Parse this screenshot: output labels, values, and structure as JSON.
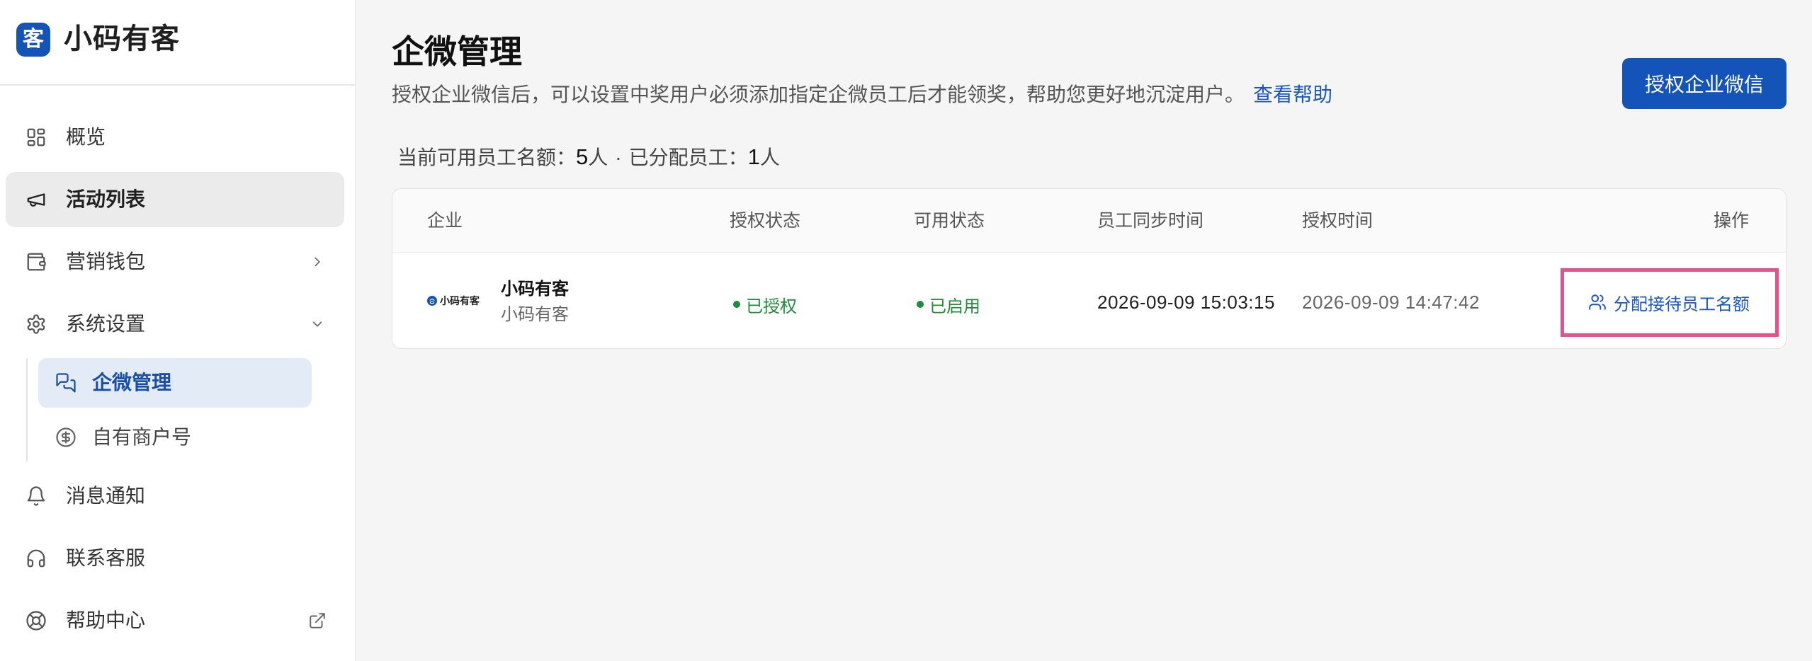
{
  "app": {
    "name": "小码有客",
    "logo_glyph": "客"
  },
  "colors": {
    "primary": "#1453b8",
    "link": "#1a56c4",
    "success": "#1e8c3a",
    "highlight": "#e8508c",
    "sidebar_active_bg": "#ebebeb",
    "submenu_active_bg": "#e3ebf7",
    "submenu_active_text": "#1a4fa8"
  },
  "sidebar": {
    "items": [
      {
        "label": "概览",
        "icon": "dashboard-icon"
      },
      {
        "label": "活动列表",
        "icon": "megaphone-icon",
        "active": true
      },
      {
        "label": "营销钱包",
        "icon": "wallet-icon",
        "trailing_icon": "chevron-right-icon"
      },
      {
        "label": "系统设置",
        "icon": "gear-icon",
        "trailing_icon": "chevron-down-icon",
        "expanded": true,
        "children": [
          {
            "label": "企微管理",
            "icon": "chat-bubbles-icon",
            "active": true
          },
          {
            "label": "自有商户号",
            "icon": "dollar-circle-icon"
          }
        ]
      },
      {
        "label": "消息通知",
        "icon": "bell-icon"
      },
      {
        "label": "联系客服",
        "icon": "headset-icon"
      },
      {
        "label": "帮助中心",
        "icon": "lifebuoy-icon",
        "trailing_icon": "external-link-icon"
      }
    ]
  },
  "page": {
    "title": "企微管理",
    "description": "授权企业微信后，可以设置中奖用户必须添加指定企微员工后才能领奖，帮助您更好地沉淀用户。",
    "help_link": "查看帮助",
    "primary_button": "授权企业微信",
    "quota": {
      "available_label": "当前可用员工名额：",
      "available_value": "5",
      "unit": "人",
      "separator": "·",
      "assigned_label": "已分配员工：",
      "assigned_value": "1"
    }
  },
  "table": {
    "columns": [
      "企业",
      "授权状态",
      "可用状态",
      "员工同步时间",
      "授权时间",
      "操作"
    ],
    "rows": [
      {
        "logo_text": "小码有客",
        "name": "小码有客",
        "subname": "小码有客",
        "auth_status": "已授权",
        "use_status": "已启用",
        "sync_time": "2026-09-09 15:03:15",
        "auth_time": "2026-09-09 14:47:42",
        "action": "分配接待员工名额",
        "action_icon": "users-icon"
      }
    ]
  }
}
